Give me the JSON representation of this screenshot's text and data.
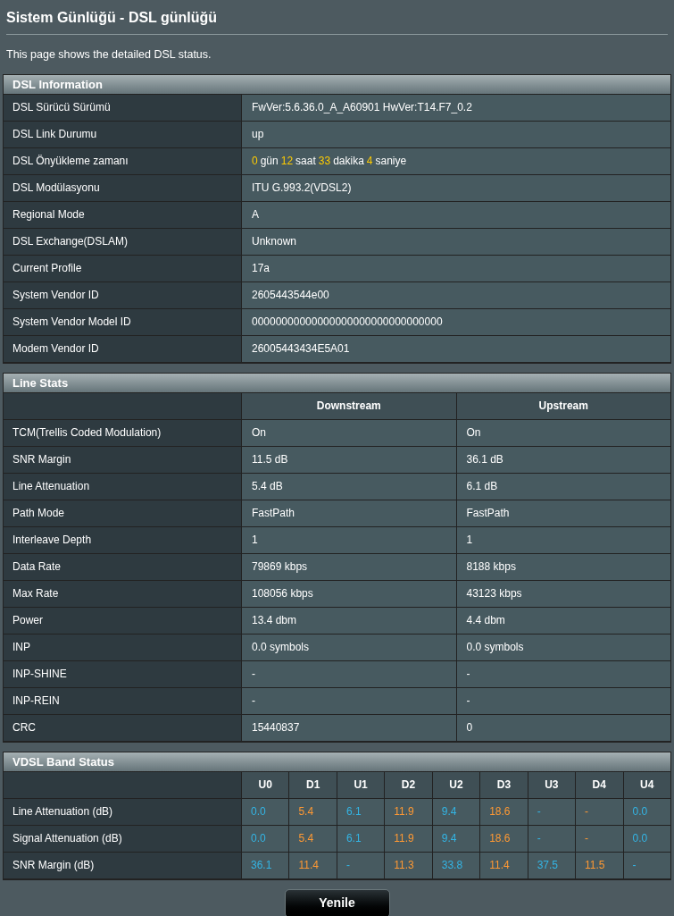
{
  "page_title": "Sistem Günlüğü - DSL günlüğü",
  "description": "This page shows the detailed DSL status.",
  "dsl_information": {
    "title": "DSL Information",
    "rows": [
      {
        "label": "DSL Sürücü Sürümü",
        "value": "FwVer:5.6.36.0_A_A60901 HwVer:T14.F7_0.2"
      },
      {
        "label": "DSL Link Durumu",
        "value": "up"
      },
      {
        "label": "DSL Önyükleme zamanı",
        "parts": [
          {
            "kind": "number",
            "text": "0"
          },
          {
            "kind": "unit",
            "text": "gün"
          },
          {
            "kind": "number",
            "text": "12"
          },
          {
            "kind": "unit",
            "text": "saat"
          },
          {
            "kind": "number",
            "text": "33"
          },
          {
            "kind": "unit",
            "text": "dakika"
          },
          {
            "kind": "number",
            "text": "4"
          },
          {
            "kind": "unit",
            "text": "saniye"
          }
        ]
      },
      {
        "label": "DSL Modülasyonu",
        "value": "ITU G.993.2(VDSL2)"
      },
      {
        "label": "Regional Mode",
        "value": "A"
      },
      {
        "label": "DSL Exchange(DSLAM)",
        "value": "Unknown"
      },
      {
        "label": "Current Profile",
        "value": "17a"
      },
      {
        "label": "System Vendor ID",
        "value": "2605443544e00"
      },
      {
        "label": "System Vendor Model ID",
        "value": "00000000000000000000000000000000"
      },
      {
        "label": "Modem Vendor ID",
        "value": "26005443434E5A01"
      }
    ]
  },
  "line_stats": {
    "title": "Line Stats",
    "columns": [
      "Downstream",
      "Upstream"
    ],
    "rows": [
      {
        "label": "TCM(Trellis Coded Modulation)",
        "values": [
          "On",
          "On"
        ]
      },
      {
        "label": "SNR Margin",
        "values": [
          "11.5 dB",
          "36.1 dB"
        ]
      },
      {
        "label": "Line Attenuation",
        "values": [
          "5.4 dB",
          "6.1 dB"
        ]
      },
      {
        "label": "Path Mode",
        "values": [
          "FastPath",
          "FastPath"
        ]
      },
      {
        "label": "Interleave Depth",
        "values": [
          "1",
          "1"
        ]
      },
      {
        "label": "Data Rate",
        "values": [
          "79869 kbps",
          "8188 kbps"
        ]
      },
      {
        "label": "Max Rate",
        "values": [
          "108056 kbps",
          "43123 kbps"
        ]
      },
      {
        "label": "Power",
        "values": [
          "13.4 dbm",
          "4.4 dbm"
        ]
      },
      {
        "label": "INP",
        "values": [
          "0.0 symbols",
          "0.0 symbols"
        ]
      },
      {
        "label": "INP-SHINE",
        "values": [
          "-",
          "-"
        ]
      },
      {
        "label": "INP-REIN",
        "values": [
          "-",
          "-"
        ]
      },
      {
        "label": "CRC",
        "values": [
          "15440837",
          "0"
        ]
      }
    ]
  },
  "vdsl_band_status": {
    "title": "VDSL Band Status",
    "columns": [
      {
        "label": "U0",
        "kind": "up"
      },
      {
        "label": "D1",
        "kind": "down"
      },
      {
        "label": "U1",
        "kind": "up"
      },
      {
        "label": "D2",
        "kind": "down"
      },
      {
        "label": "U2",
        "kind": "up"
      },
      {
        "label": "D3",
        "kind": "down"
      },
      {
        "label": "U3",
        "kind": "up"
      },
      {
        "label": "D4",
        "kind": "down"
      },
      {
        "label": "U4",
        "kind": "up"
      }
    ],
    "rows": [
      {
        "label": "Line Attenuation (dB)",
        "values": [
          "0.0",
          "5.4",
          "6.1",
          "11.9",
          "9.4",
          "18.6",
          "-",
          "-",
          "0.0"
        ]
      },
      {
        "label": "Signal Attenuation (dB)",
        "values": [
          "0.0",
          "5.4",
          "6.1",
          "11.9",
          "9.4",
          "18.6",
          "-",
          "-",
          "0.0"
        ]
      },
      {
        "label": "SNR Margin (dB)",
        "values": [
          "36.1",
          "11.4",
          "-",
          "11.3",
          "33.8",
          "11.4",
          "37.5",
          "11.5",
          "-"
        ]
      }
    ]
  },
  "refresh_button": "Yenile"
}
